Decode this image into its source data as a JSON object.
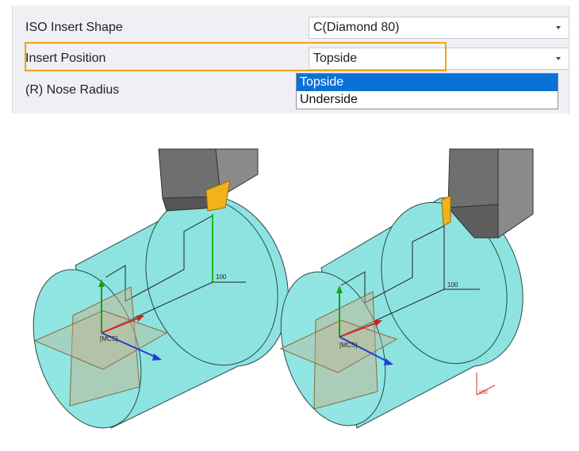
{
  "properties": {
    "rows": [
      {
        "label": "ISO Insert Shape",
        "value": "C(Diamond 80)"
      },
      {
        "label": "Insert Position",
        "value": "Topside"
      },
      {
        "label": "(R) Nose Radius",
        "value": ""
      }
    ]
  },
  "dropdown": {
    "options": [
      "Topside",
      "Underside"
    ],
    "selected": "Topside"
  },
  "viewport": {
    "left": {
      "csys_label": "[MCS]",
      "dim_label": "100",
      "x_axis_label": "X",
      "y_axis_label": "Y"
    },
    "right": {
      "csys_label": "[MCS]",
      "dim_label": "100",
      "x_axis_label": "X",
      "y_axis_label": "Y",
      "z_axis_label": "Z",
      "small_dim_label": "100"
    }
  },
  "colors": {
    "highlight": "#f0a31a",
    "selection": "#0a72d6",
    "stock": "#8de3e0",
    "insert": "#f2b21b",
    "holder": "#6f6f6f"
  }
}
